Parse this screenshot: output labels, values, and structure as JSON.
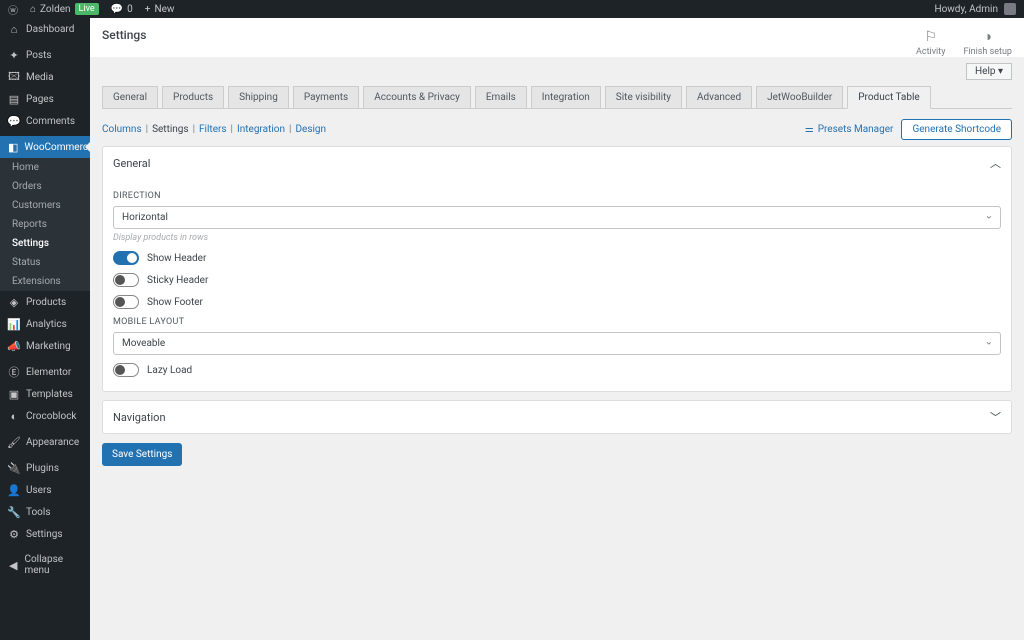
{
  "adminBar": {
    "siteName": "Zolden",
    "liveBadge": "Live",
    "commentsCount": "0",
    "newLabel": "New",
    "howdy": "Howdy, Admin"
  },
  "sidebar": {
    "items": [
      {
        "icon": "⌂",
        "label": "Dashboard"
      },
      {
        "icon": "✦",
        "label": "Posts"
      },
      {
        "icon": "🖾",
        "label": "Media"
      },
      {
        "icon": "▤",
        "label": "Pages"
      },
      {
        "icon": "💬",
        "label": "Comments"
      },
      {
        "icon": "◧",
        "label": "WooCommerce",
        "active": true
      },
      {
        "icon": "◈",
        "label": "Products"
      },
      {
        "icon": "📊",
        "label": "Analytics"
      },
      {
        "icon": "📣",
        "label": "Marketing"
      },
      {
        "icon": "Ⓔ",
        "label": "Elementor"
      },
      {
        "icon": "▣",
        "label": "Templates"
      },
      {
        "icon": "◐",
        "label": "Crocoblock"
      },
      {
        "icon": "🖌",
        "label": "Appearance"
      },
      {
        "icon": "🔌",
        "label": "Plugins"
      },
      {
        "icon": "👤",
        "label": "Users"
      },
      {
        "icon": "🔧",
        "label": "Tools"
      },
      {
        "icon": "⚙",
        "label": "Settings"
      },
      {
        "icon": "◀",
        "label": "Collapse menu"
      }
    ],
    "submenu": [
      {
        "label": "Home"
      },
      {
        "label": "Orders"
      },
      {
        "label": "Customers"
      },
      {
        "label": "Reports"
      },
      {
        "label": "Settings",
        "active": true
      },
      {
        "label": "Status"
      },
      {
        "label": "Extensions"
      }
    ]
  },
  "header": {
    "title": "Settings",
    "activity": "Activity",
    "finishSetup": "Finish setup",
    "helpLabel": "Help ▾"
  },
  "tabs": [
    "General",
    "Products",
    "Shipping",
    "Payments",
    "Accounts & Privacy",
    "Emails",
    "Integration",
    "Site visibility",
    "Advanced",
    "JetWooBuilder",
    "Product Table"
  ],
  "activeTab": "Product Table",
  "subtabs": [
    "Columns",
    "Settings",
    "Filters",
    "Integration",
    "Design"
  ],
  "activeSubtab": "Settings",
  "subtabActions": {
    "presets": "Presets Manager",
    "generate": "Generate Shortcode"
  },
  "panels": {
    "general": {
      "title": "General",
      "directionLabel": "DIRECTION",
      "directionValue": "Horizontal",
      "directionHint": "Display products in rows",
      "showHeader": "Show Header",
      "stickyHeader": "Sticky Header",
      "showFooter": "Show Footer",
      "mobileLayoutLabel": "MOBILE LAYOUT",
      "mobileLayoutValue": "Moveable",
      "lazyLoad": "Lazy Load"
    },
    "navigation": {
      "title": "Navigation"
    }
  },
  "saveLabel": "Save Settings"
}
